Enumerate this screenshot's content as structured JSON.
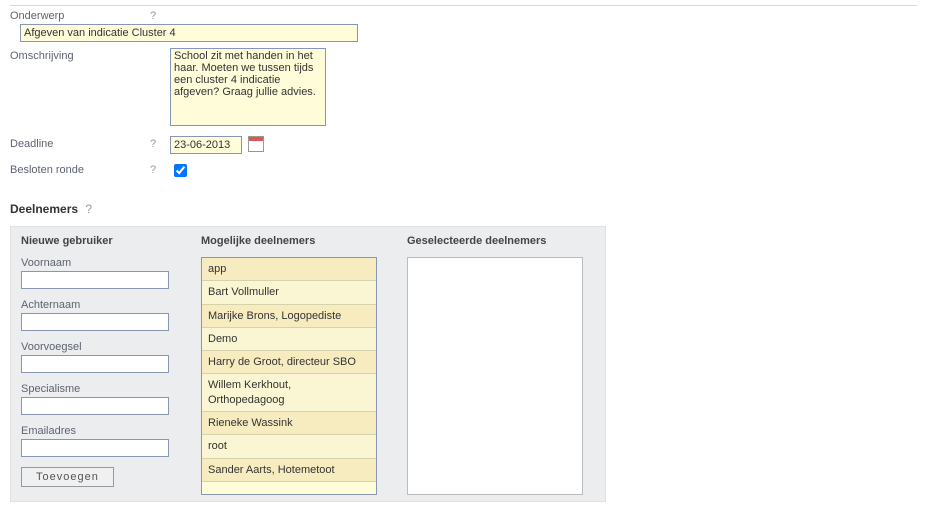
{
  "fields": {
    "subject_label": "Onderwerp",
    "subject_value": "Afgeven van indicatie Cluster 4",
    "description_label": "Omschrijving",
    "description_value": "School zit met handen in het haar. Moeten we tussen tijds een cluster 4 indicatie afgeven? Graag jullie advies.",
    "deadline_label": "Deadline",
    "deadline_value": "23-06-2013",
    "closed_round_label": "Besloten ronde",
    "help": "?"
  },
  "participants": {
    "header": "Deelnemers",
    "new_user": {
      "title": "Nieuwe gebruiker",
      "firstname": "Voornaam",
      "lastname": "Achternaam",
      "prefix": "Voorvoegsel",
      "specialism": "Specialisme",
      "email": "Emailadres",
      "add_button": "Toevoegen"
    },
    "possible": {
      "title": "Mogelijke deelnemers",
      "items": [
        "app",
        "Bart Vollmuller",
        "Marijke Brons, Logopediste",
        "Demo",
        "Harry de Groot, directeur SBO",
        "Willem Kerkhout, Orthopedagoog",
        "Rieneke Wassink",
        "root",
        "Sander Aarts, Hotemetoot"
      ]
    },
    "selected": {
      "title": "Geselecteerde deelnemers"
    }
  }
}
